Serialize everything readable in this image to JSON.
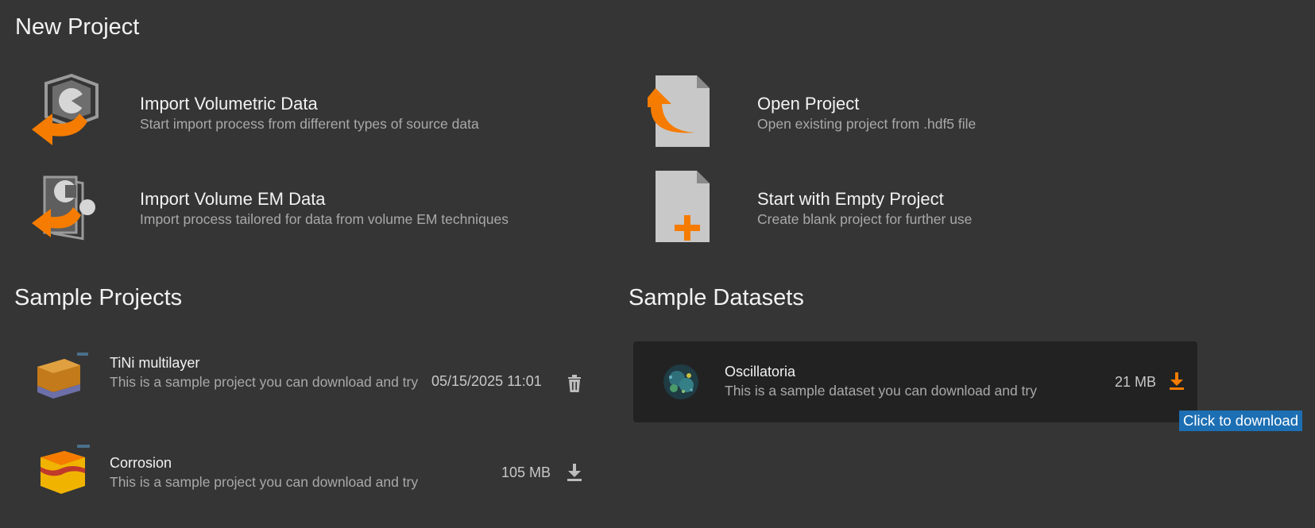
{
  "new_project": {
    "heading": "New Project",
    "actions": [
      {
        "title": "Import Volumetric Data",
        "subtitle": "Start import process from different types of source data",
        "icon": "import-volumetric-icon"
      },
      {
        "title": "Open Project",
        "subtitle": "Open existing project from .hdf5 file",
        "icon": "open-file-icon"
      },
      {
        "title": "Import Volume EM Data",
        "subtitle": "Import process tailored for data from volume EM techniques",
        "icon": "import-em-icon"
      },
      {
        "title": "Start with Empty Project",
        "subtitle": "Create blank project for further use",
        "icon": "new-file-icon"
      }
    ]
  },
  "sample_projects": {
    "heading": "Sample Projects",
    "items": [
      {
        "title": "TiNi multilayer",
        "subtitle": "This is a sample project you can download and try",
        "meta": "05/15/2025 11:01",
        "action_icon": "trash-icon"
      },
      {
        "title": "Corrosion",
        "subtitle": "This is a sample project you can download and try",
        "meta": "105 MB",
        "action_icon": "download-icon"
      }
    ]
  },
  "sample_datasets": {
    "heading": "Sample Datasets",
    "items": [
      {
        "title": "Oscillatoria",
        "subtitle": "This is a sample dataset you can download and try",
        "meta": "21 MB",
        "action_icon": "download-icon"
      }
    ],
    "tooltip": "Click to download"
  },
  "colors": {
    "background": "#353535",
    "accent": "#f57c00",
    "card": "#222222",
    "tooltip": "#1d6fb3"
  }
}
